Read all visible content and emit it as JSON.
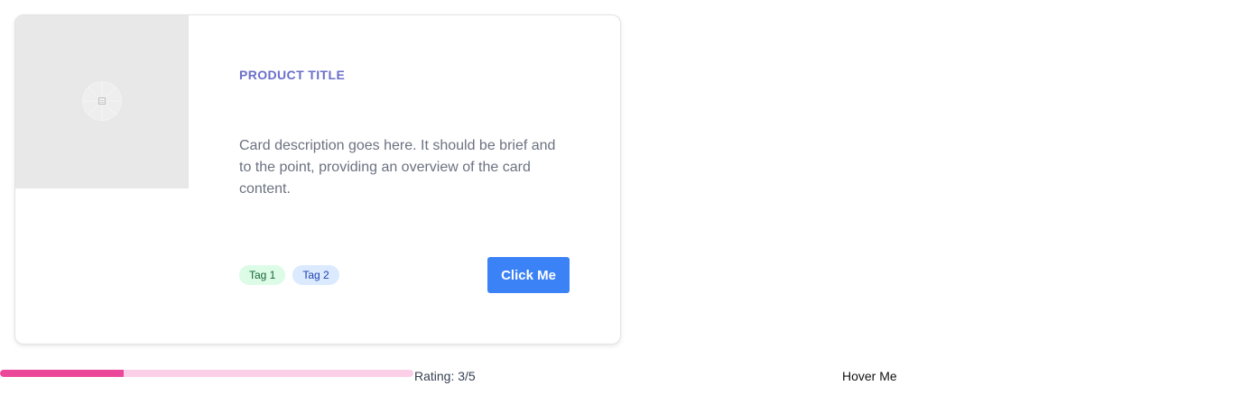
{
  "card": {
    "image_icon": "image-placeholder-icon",
    "title": "PRODUCT TITLE",
    "description": "Card description goes here. It should be brief and to the point, providing an overview of the card content.",
    "tags": [
      "Tag 1",
      "Tag 2"
    ],
    "button_label": "Click Me",
    "colors": {
      "title": "#6a6fc9",
      "button": "#3b82f6",
      "tag1_bg": "#dcfce7",
      "tag2_bg": "#dbeafe"
    }
  },
  "progress": {
    "value": 0.3,
    "fill_color": "#ec4899",
    "track_color": "#fbcfe8"
  },
  "rating": {
    "label": "Rating: 3/5",
    "value": 3,
    "max": 5
  },
  "hover_text": "Hover Me"
}
